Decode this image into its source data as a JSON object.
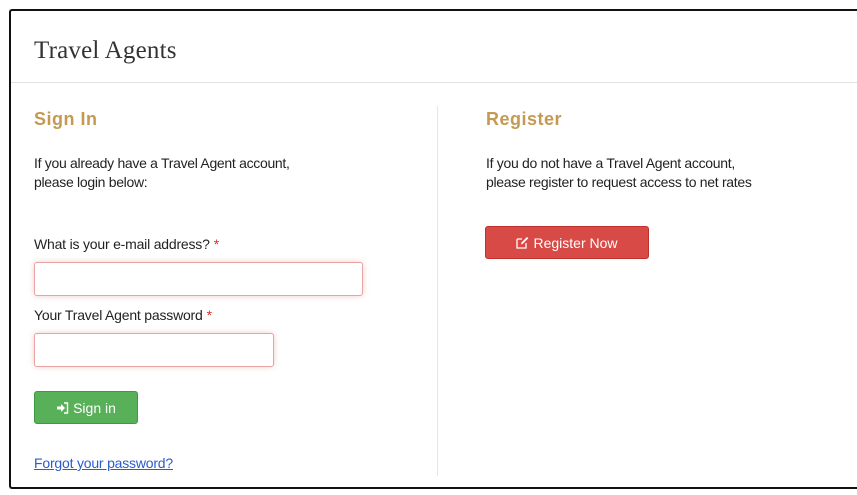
{
  "panel": {
    "title": "Travel Agents"
  },
  "sign_in": {
    "title": "Sign In",
    "intro_line1": "If you already have a Travel Agent account,",
    "intro_line2": "please login below:",
    "email_label": "What is your e-mail address?",
    "password_label": "Your Travel Agent password",
    "required_mark": "*",
    "email_value": "",
    "password_value": "",
    "submit_label": "Sign in",
    "submit_icon": "sign-in-icon",
    "forgot_link": "Forgot your password?"
  },
  "register": {
    "title": "Register",
    "intro_line1": "If you do not have a Travel Agent account,",
    "intro_line2": "please register to request access to net rates",
    "button_label": "Register Now",
    "button_icon": "edit-icon"
  },
  "colors": {
    "section_title": "#c49a52",
    "required": "#d2322d",
    "sign_in_button": "#58b058",
    "register_button": "#d74a46",
    "link": "#2a5ccc"
  }
}
